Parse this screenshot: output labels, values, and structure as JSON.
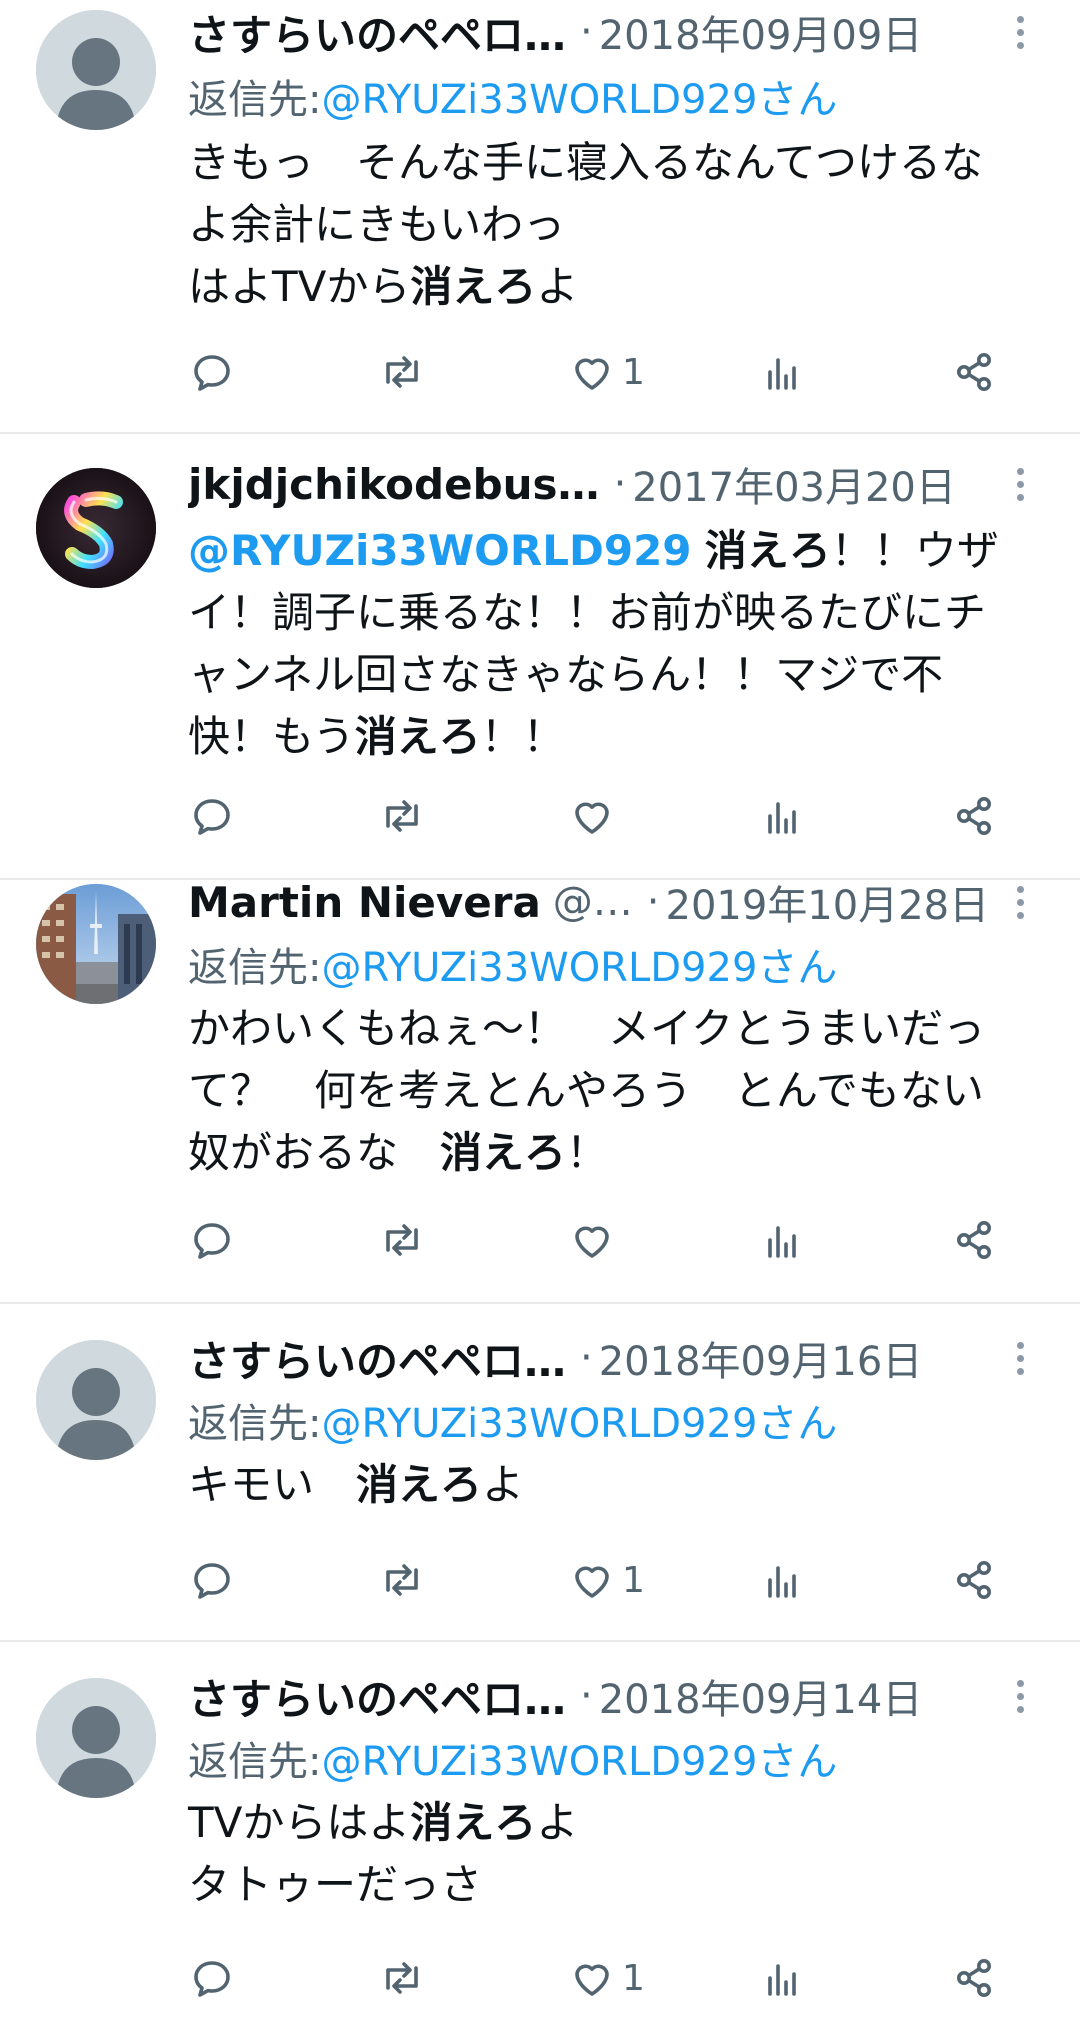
{
  "tweets": [
    {
      "name": "さすらいのペペロ…",
      "handle": "",
      "date": "2018年09月09日",
      "reply_prefix": "返信先: ",
      "reply_to": "@RYUZi33WORLD929さん",
      "body_lines": [
        [
          {
            "t": "きもっ　そんな手に寝入るなんてつけるな",
            "s": "normal"
          }
        ],
        [
          {
            "t": "よ余計にきもいわっ",
            "s": "normal"
          }
        ],
        [
          {
            "t": "はよTVから",
            "s": "normal"
          },
          {
            "t": "消えろ",
            "s": "bold"
          },
          {
            "t": "よ",
            "s": "normal"
          }
        ]
      ],
      "like_count": "1"
    },
    {
      "name": "jkjdjchikodebus…",
      "handle": "",
      "date": "2017年03月20日",
      "reply_prefix": "",
      "reply_to": "",
      "body_lines": [
        [
          {
            "t": "@RYUZi33WORLD929",
            "s": "mention"
          },
          {
            "t": " ",
            "s": "normal"
          },
          {
            "t": "消えろ",
            "s": "bold"
          },
          {
            "t": "！！ウザ",
            "s": "normal"
          }
        ],
        [
          {
            "t": "イ！調子に乗るな！！お前が映るたびにチ",
            "s": "normal"
          }
        ],
        [
          {
            "t": "ャンネル回さなきゃならん！！マジで不",
            "s": "normal"
          }
        ],
        [
          {
            "t": "快！もう",
            "s": "normal"
          },
          {
            "t": "消えろ",
            "s": "bold"
          },
          {
            "t": "！！",
            "s": "normal"
          }
        ]
      ],
      "like_count": ""
    },
    {
      "name": "Martin Nievera",
      "handle": "@…",
      "date": "2019年10月28日",
      "reply_prefix": "返信先: ",
      "reply_to": "@RYUZi33WORLD929さん",
      "body_lines": [
        [
          {
            "t": "かわいくもねぇ〜！　メイクとうまいだっ",
            "s": "normal"
          }
        ],
        [
          {
            "t": "て？　何を考えとんやろう　とんでもない",
            "s": "normal"
          }
        ],
        [
          {
            "t": "奴がおるな　",
            "s": "normal"
          },
          {
            "t": "消えろ",
            "s": "bold"
          },
          {
            "t": "！",
            "s": "normal"
          }
        ]
      ],
      "like_count": ""
    },
    {
      "name": "さすらいのペペロ…",
      "handle": "",
      "date": "2018年09月16日",
      "reply_prefix": "返信先: ",
      "reply_to": "@RYUZi33WORLD929さん",
      "body_lines": [
        [
          {
            "t": "キモい　",
            "s": "normal"
          },
          {
            "t": "消えろ",
            "s": "bold"
          },
          {
            "t": "よ",
            "s": "normal"
          }
        ]
      ],
      "like_count": "1"
    },
    {
      "name": "さすらいのペペロ…",
      "handle": "",
      "date": "2018年09月14日",
      "reply_prefix": "返信先: ",
      "reply_to": "@RYUZi33WORLD929さん",
      "body_lines": [
        [
          {
            "t": "TVからはよ",
            "s": "normal"
          },
          {
            "t": "消えろ",
            "s": "bold"
          },
          {
            "t": "よ",
            "s": "normal"
          }
        ],
        [
          {
            "t": "タトゥーだっさ",
            "s": "normal"
          }
        ]
      ],
      "like_count": "1"
    }
  ],
  "separator": "·",
  "icons": {
    "reply": "reply-icon",
    "retweet": "retweet-icon",
    "like": "heart-icon",
    "views": "views-icon",
    "share": "share-icon",
    "more": "more-icon"
  },
  "colors": {
    "text": "#0f1419",
    "secondary": "#536471",
    "link": "#1d9bf0",
    "divider": "#e7e9ea",
    "avatar_default": "#cfd9de",
    "avatar_figure": "#66757f"
  }
}
